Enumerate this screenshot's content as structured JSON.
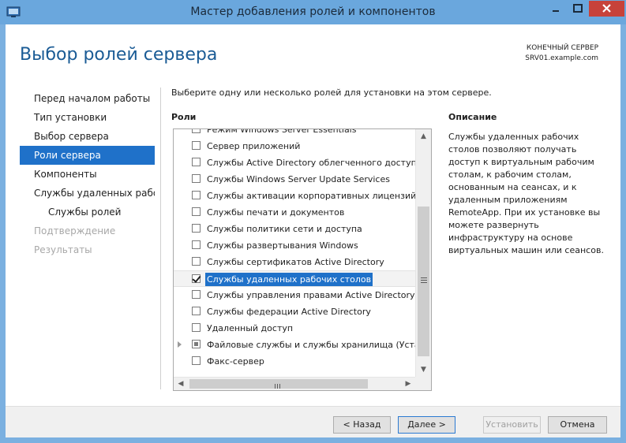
{
  "window": {
    "title": "Мастер добавления ролей и компонентов"
  },
  "page": {
    "title": "Выбор ролей сервера",
    "destination_label": "КОНЕЧНЫЙ СЕРВЕР",
    "destination_server": "SRV01.example.com"
  },
  "nav": {
    "items": [
      {
        "label": "Перед началом работы",
        "state": "normal"
      },
      {
        "label": "Тип установки",
        "state": "normal"
      },
      {
        "label": "Выбор сервера",
        "state": "normal"
      },
      {
        "label": "Роли сервера",
        "state": "active"
      },
      {
        "label": "Компоненты",
        "state": "normal"
      },
      {
        "label": "Службы удаленных рабо...",
        "state": "normal"
      },
      {
        "label": "Службы ролей",
        "state": "sub"
      },
      {
        "label": "Подтверждение",
        "state": "disabled"
      },
      {
        "label": "Результаты",
        "state": "disabled"
      }
    ]
  },
  "main": {
    "instruction": "Выберите одну или несколько ролей для установки на этом сервере.",
    "roles_header": "Роли",
    "description_header": "Описание",
    "description_text": "Службы удаленных рабочих столов позволяют получать доступ к виртуальным рабочим столам, к рабочим столам, основанным на сеансах, и к удаленным приложениям RemoteApp. При их установке вы можете развернуть инфраструктуру на основе виртуальных машин или сеансов.",
    "roles": [
      {
        "label": "Режим Windows Server Essentials",
        "state": "unchecked"
      },
      {
        "label": "Сервер приложений",
        "state": "unchecked"
      },
      {
        "label": "Службы Active Directory облегченного доступа к",
        "state": "unchecked"
      },
      {
        "label": "Службы Windows Server Update Services",
        "state": "unchecked"
      },
      {
        "label": "Службы активации корпоративных лицензий",
        "state": "unchecked"
      },
      {
        "label": "Службы печати и документов",
        "state": "unchecked"
      },
      {
        "label": "Службы политики сети и доступа",
        "state": "unchecked"
      },
      {
        "label": "Службы развертывания Windows",
        "state": "unchecked"
      },
      {
        "label": "Службы сертификатов Active Directory",
        "state": "unchecked"
      },
      {
        "label": "Службы удаленных рабочих столов",
        "state": "checked",
        "selected": true
      },
      {
        "label": "Службы управления правами Active Directory",
        "state": "unchecked"
      },
      {
        "label": "Службы федерации Active Directory",
        "state": "unchecked"
      },
      {
        "label": "Удаленный доступ",
        "state": "unchecked"
      },
      {
        "label": "Файловые службы и службы хранилища (Установ",
        "state": "partial",
        "expandable": true
      },
      {
        "label": "Факс-сервер",
        "state": "unchecked"
      }
    ]
  },
  "buttons": {
    "back": "< Назад",
    "next": "Далее >",
    "install": "Установить",
    "cancel": "Отмена"
  },
  "colors": {
    "accent": "#1f71c9",
    "title_blue": "#1a5b95",
    "titlebar": "#6aa7dd",
    "close": "#c7423a"
  }
}
